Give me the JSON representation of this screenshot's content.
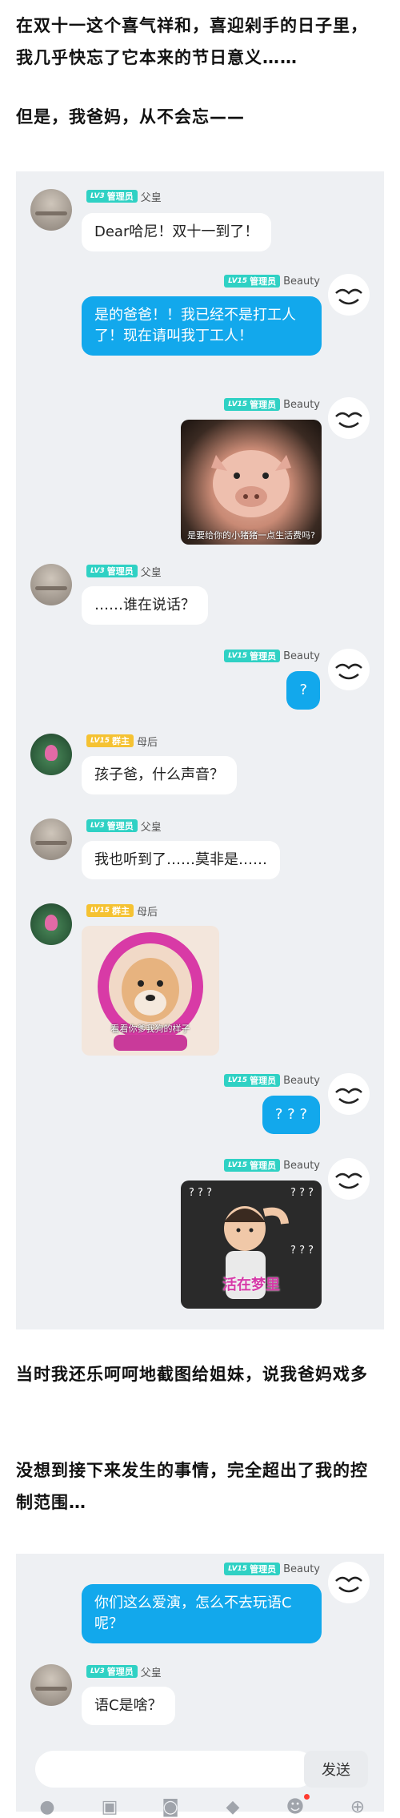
{
  "intro": {
    "line1": "在双十一这个喜气祥和，喜迎剁手的日子里，我几乎快忘了它本来的节日意义……",
    "line2": "但是，我爸妈，从不会忘——"
  },
  "middle": {
    "line1": "当时我还乐呵呵地截图给姐妹，说我爸妈戏多",
    "line2": "没想到接下来发生的事情，完全超出了我的控制范围…"
  },
  "badges": {
    "lv3": "LV3",
    "lv15": "LV15",
    "admin": "管理员",
    "owner": "群主"
  },
  "names": {
    "dad": "父皇",
    "mom": "母后",
    "me": "Beauty"
  },
  "chat1": {
    "m1": "Dear哈尼！双十一到了！",
    "m2": "是的爸爸！！我已经不是打工人了！现在请叫我丁工人！",
    "m3_caption": "是要给你的小猪猪一点生活费吗?",
    "m4": "……谁在说话？",
    "m5": "?",
    "m6": "孩子爸，什么声音？",
    "m7": "我也听到了……莫非是……",
    "m8_caption": "看看你爹我狗的样子",
    "m9": "? ? ?",
    "m10_caption": "活在梦里",
    "m10_marks": "? ? ?"
  },
  "chat2": {
    "m1": "你们这么爱演，怎么不去玩语C呢？",
    "m2": "语C是啥？",
    "send": "发送"
  },
  "toolbar": {
    "icons": [
      "mic-icon",
      "image-icon",
      "camera-icon",
      "hongbao-icon",
      "emoji-icon",
      "plus-icon"
    ]
  }
}
